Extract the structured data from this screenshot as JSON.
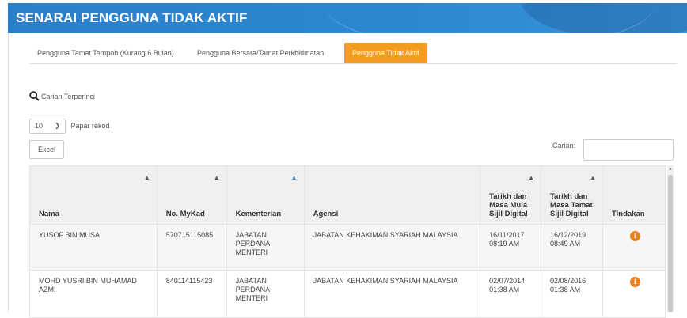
{
  "header": {
    "title": "SENARAI PENGGUNA TIDAK AKTIF"
  },
  "tabs": [
    {
      "label": "Pengguna Tamat Tempoh (Kurang 6 Bulan)"
    },
    {
      "label": "Pengguna Bersara/Tamat Perkhidmatan"
    },
    {
      "label": "Pengguna Tidak Aktif",
      "active": true
    }
  ],
  "search_advanced": {
    "label": "Carian Terperinci",
    "icon": "search-icon"
  },
  "page_length": {
    "value": "10",
    "label": "Papar rekod"
  },
  "excel_button": {
    "label": "Excel"
  },
  "filter": {
    "label": "Carian:",
    "value": ""
  },
  "table": {
    "columns": [
      {
        "label": "Nama",
        "sort": "both"
      },
      {
        "label": "No. MyKad",
        "sort": "both"
      },
      {
        "label": "Kementerian",
        "sort": "asc"
      },
      {
        "label": "Agensi",
        "sort": "none"
      },
      {
        "label": "Tarikh dan Masa Mula Sijil Digital",
        "sort": "both"
      },
      {
        "label": "Tarikh dan Masa Tamat Sijil Digital",
        "sort": "both"
      },
      {
        "label": "Tindakan",
        "sort": "none"
      }
    ],
    "rows": [
      {
        "nama": "YUSOF BIN MUSA",
        "mykad": "570715115085",
        "kementerian": "JABATAN PERDANA MENTERI",
        "agensi": "JABATAN KEHAKIMAN SYARIAH MALAYSIA",
        "mula": "16/11/2017 08:19 AM",
        "tamat": "16/12/2019 08:49 AM",
        "action_icon": "info-icon"
      },
      {
        "nama": "MOHD YUSRI BIN MUHAMAD AZMI",
        "mykad": "840114115423",
        "kementerian": "JABATAN PERDANA MENTERI",
        "agensi": "JABATAN KEHAKIMAN SYARIAH MALAYSIA",
        "mula": "02/07/2014 01:38 AM",
        "tamat": "02/08/2016 01:38 AM",
        "action_icon": "info-icon"
      }
    ]
  },
  "colors": {
    "header": "#2d88d2",
    "active_tab": "#f39c1f",
    "info_button": "#e8822a"
  }
}
